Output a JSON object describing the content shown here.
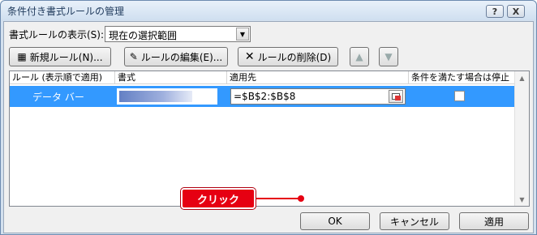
{
  "window": {
    "title": "条件付き書式ルールの管理",
    "help_label": "?",
    "close_label": "X"
  },
  "show_rules": {
    "label": "書式ルールの表示(S):",
    "value": "現在の選択範囲"
  },
  "toolbar": {
    "new_rule": "新規ルール(N)...",
    "edit_rule": "ルールの編集(E)...",
    "delete_rule": "ルールの削除(D)",
    "move_up_icon": "arrow-up-icon",
    "move_down_icon": "arrow-down-icon"
  },
  "table": {
    "headers": [
      "ルール (表示順で適用)",
      "書式",
      "適用先",
      "条件を満たす場合は停止"
    ],
    "rows": [
      {
        "rule": "データ バー",
        "format": "data-bar-preview",
        "applies_to": "=$B$2:$B$8",
        "stop_if_true": false
      }
    ]
  },
  "footer": {
    "ok": "OK",
    "cancel": "キャンセル",
    "apply": "適用"
  },
  "annotation": {
    "label": "クリック",
    "color": "#e60012"
  },
  "colors": {
    "selection": "#3399ff",
    "title_text": "#1e395b"
  }
}
